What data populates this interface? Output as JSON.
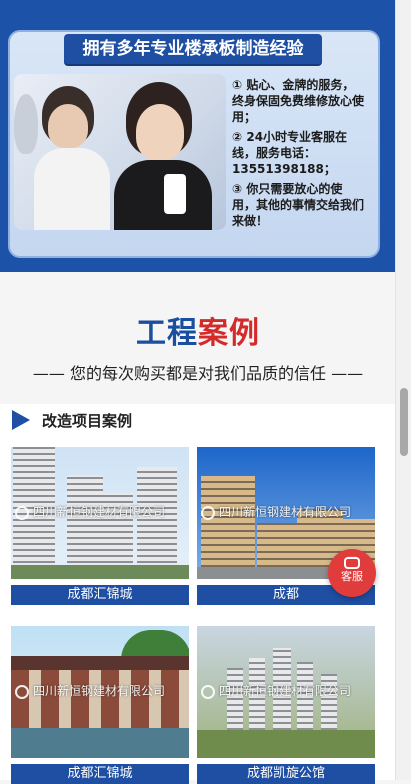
{
  "service": {
    "heading": "拥有多年专业楼承板制造经验",
    "items": [
      "① 贴心、金牌的服务，终身保固免费维修放心使用；",
      "② 24小时专业客服在线，服务电话：13551398188；",
      "③ 你只需要放心的使用，其他的事情交给我们来做！"
    ]
  },
  "cases": {
    "title_part1": "工程",
    "title_part2": "案例",
    "subtitle": "—— 您的每次购买都是对我们品质的信任 ——",
    "section_label": "改造项目案例",
    "watermark": "四川新恒钢建材有限公司",
    "tiles": [
      {
        "caption": "成都汇锦城"
      },
      {
        "caption": "成都"
      },
      {
        "caption": "成都汇锦城"
      },
      {
        "caption": "成都凯旋公馆"
      }
    ]
  },
  "floating": {
    "service_label": "客服"
  },
  "colors": {
    "brand_blue": "#1f4fa3",
    "accent_red": "#d32a2a",
    "float_red": "#e13c3c"
  }
}
